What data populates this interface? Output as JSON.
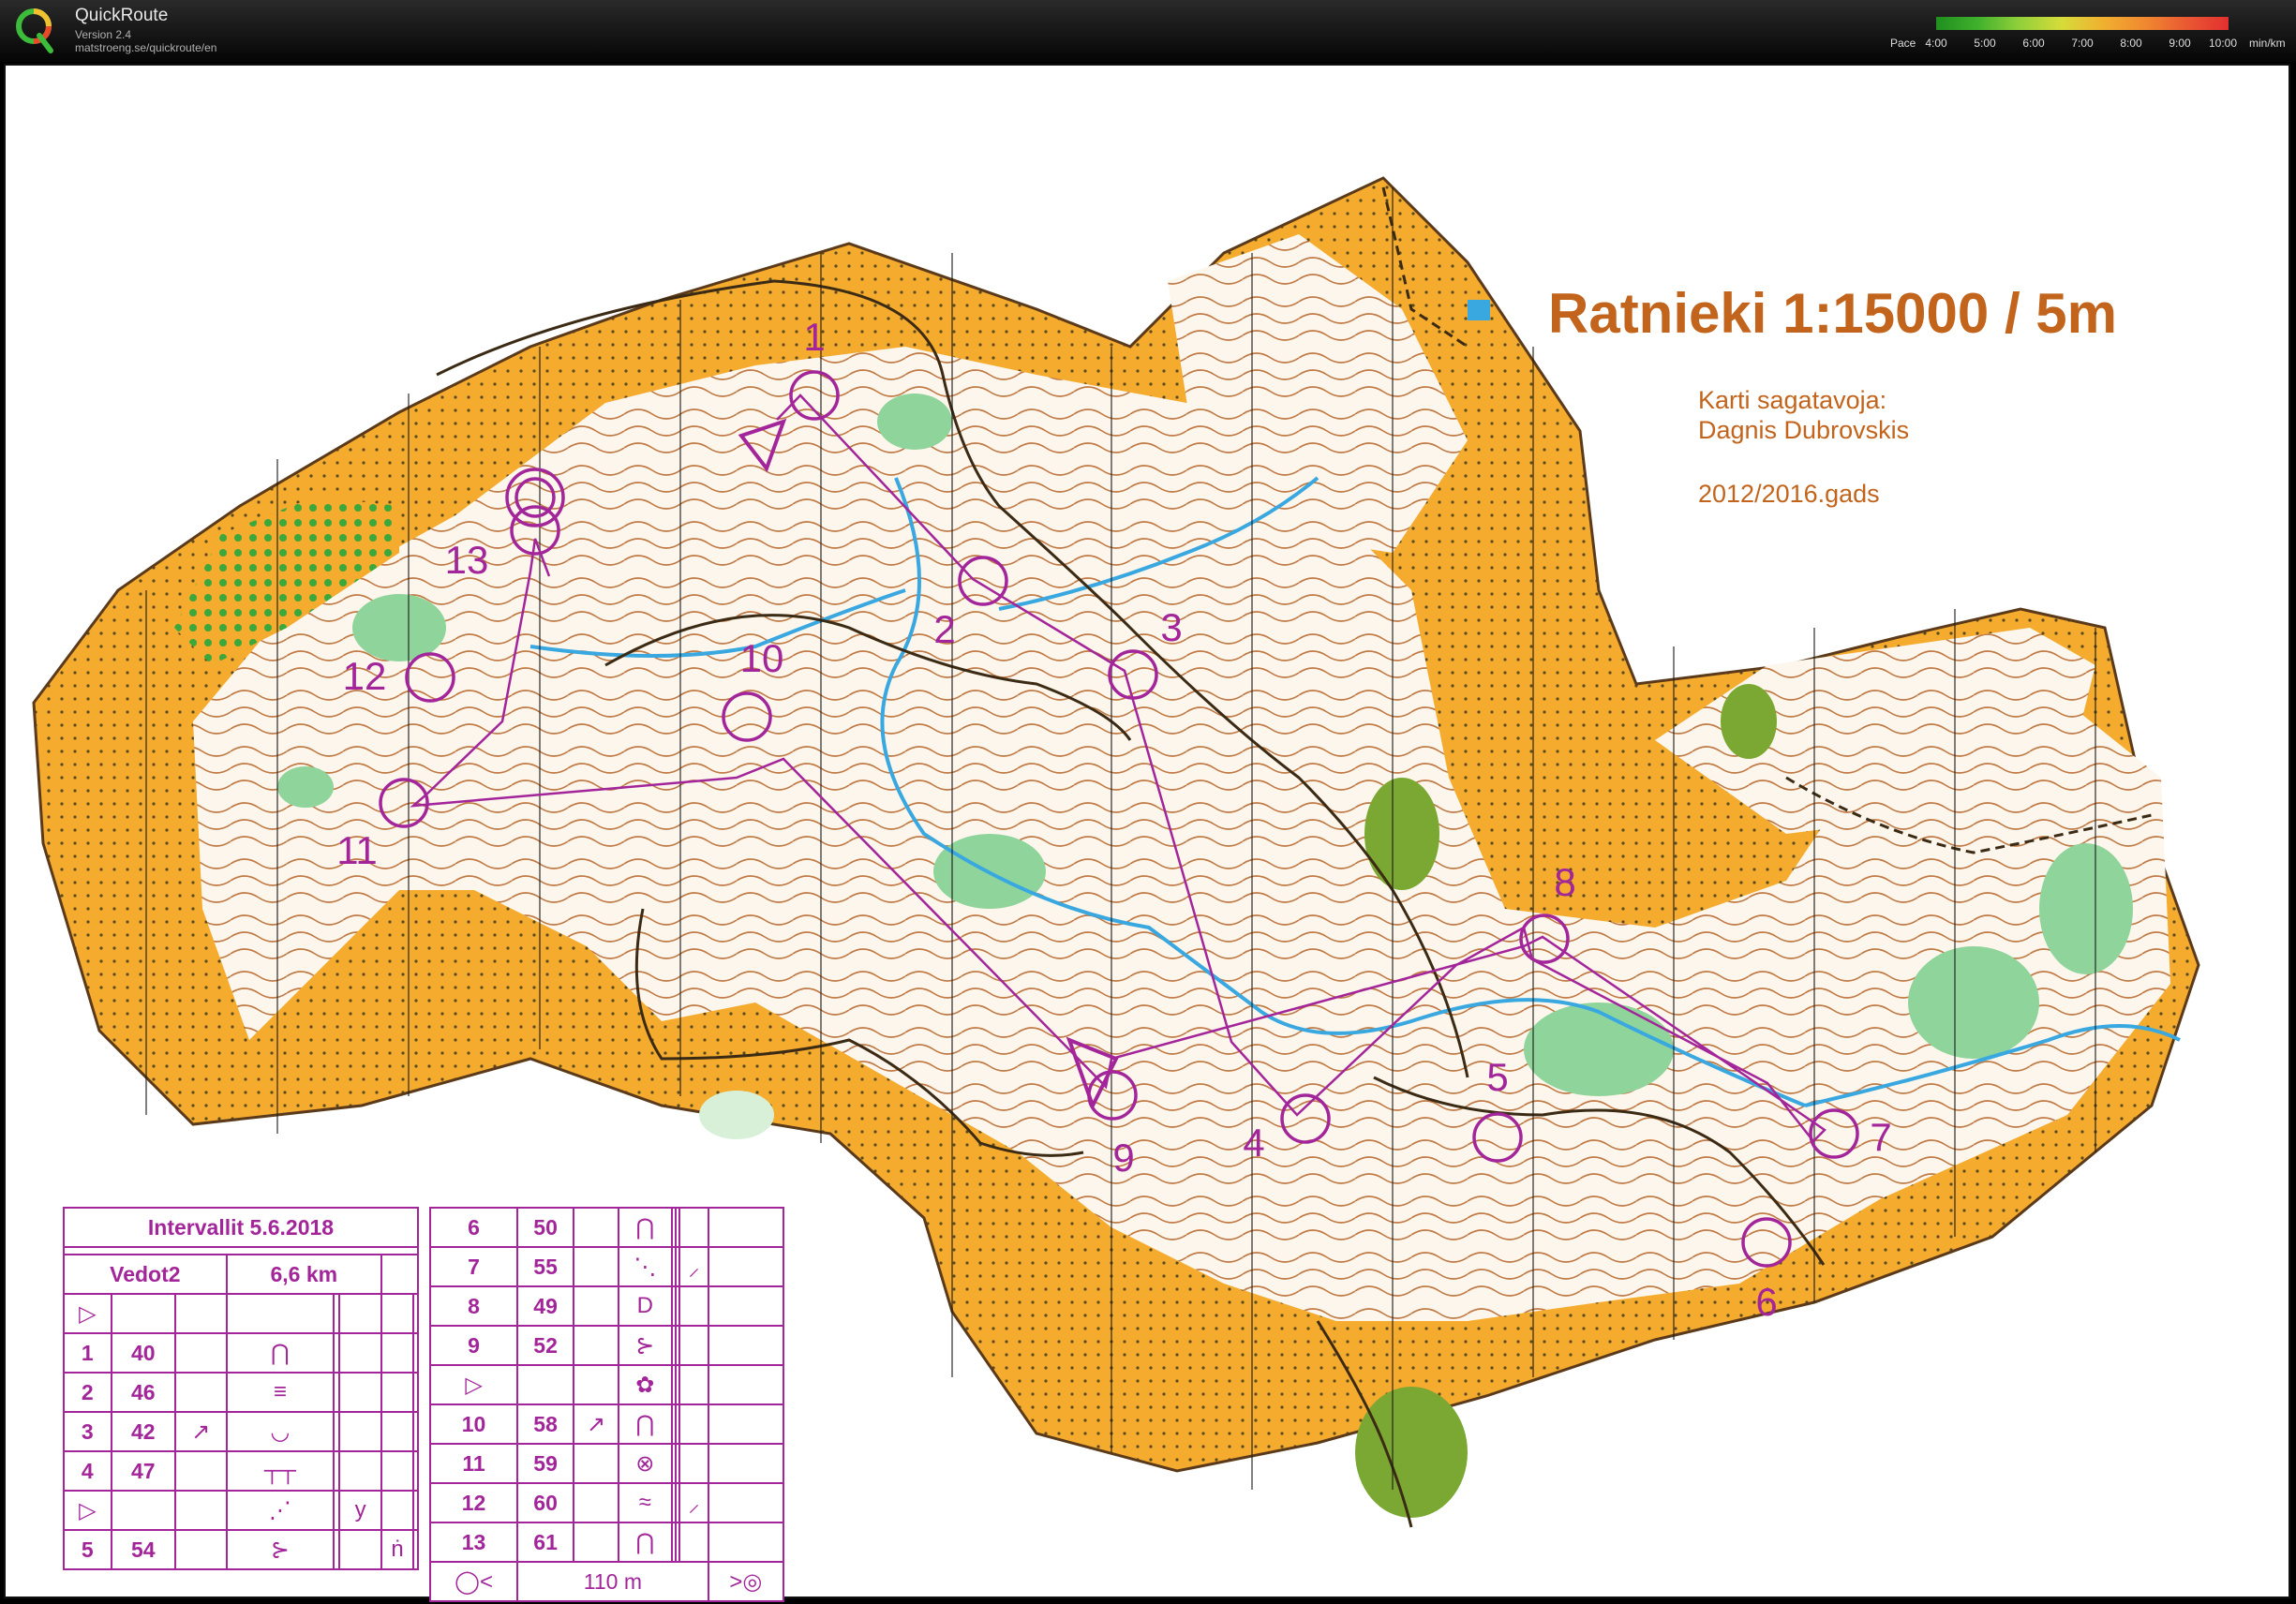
{
  "app": {
    "name": "QuickRoute",
    "version": "Version 2.4",
    "url": "matstroeng.se/quickroute/en",
    "logo_icon": "quickroute-q-logo-icon"
  },
  "pace_legend": {
    "label": "Pace",
    "ticks": [
      "4:00",
      "5:00",
      "6:00",
      "7:00",
      "8:00",
      "9:00",
      "10:00"
    ],
    "unit": "min/km",
    "colors": {
      "fast": "#1f8f1f",
      "medium": "#d6dc3a",
      "slow": "#e23030"
    }
  },
  "map": {
    "title": "Ratnieki 1:15000 / 5m",
    "credit_label": "Karti sagatavoja:",
    "credit_name": "Dagnis Dubrovskis",
    "edition": "2012/2016.gads",
    "colors": {
      "open_land": "#f5ab2d",
      "forest": "#ffffff",
      "vegetation_green": "#8fd49a",
      "contour_brown": "#b2663a",
      "water_blue": "#3aa8e0",
      "course_purple": "#a3259a"
    },
    "controls": [
      "1",
      "2",
      "3",
      "4",
      "5",
      "6",
      "7",
      "8",
      "9",
      "10",
      "11",
      "12",
      "13"
    ]
  },
  "description_sheet": {
    "event": "Intervallit 5.6.2018",
    "course": "Vedot2",
    "length": "6,6 km",
    "left_rows": [
      {
        "num": "1",
        "code": "40"
      },
      {
        "num": "2",
        "code": "46"
      },
      {
        "num": "3",
        "code": "42"
      },
      {
        "num": "4",
        "code": "47"
      },
      {
        "num": "5",
        "code": "54"
      }
    ],
    "right_rows": [
      {
        "num": "6",
        "code": "50"
      },
      {
        "num": "7",
        "code": "55"
      },
      {
        "num": "8",
        "code": "49"
      },
      {
        "num": "9",
        "code": "52"
      },
      {
        "num": "10",
        "code": "58"
      },
      {
        "num": "11",
        "code": "59"
      },
      {
        "num": "12",
        "code": "60"
      },
      {
        "num": "13",
        "code": "61"
      }
    ],
    "finish_distance": "110 m"
  }
}
